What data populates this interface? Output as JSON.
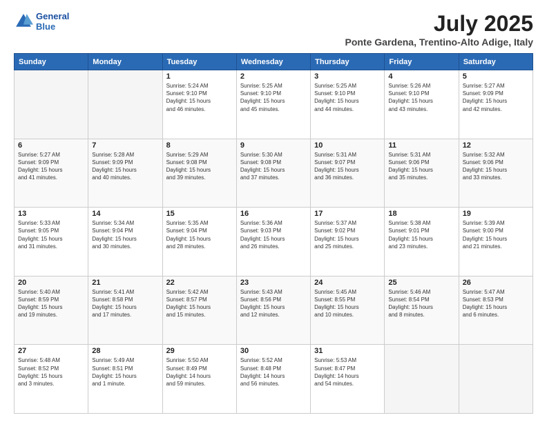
{
  "header": {
    "logo_line1": "General",
    "logo_line2": "Blue",
    "month": "July 2025",
    "location": "Ponte Gardena, Trentino-Alto Adige, Italy"
  },
  "days_of_week": [
    "Sunday",
    "Monday",
    "Tuesday",
    "Wednesday",
    "Thursday",
    "Friday",
    "Saturday"
  ],
  "weeks": [
    [
      {
        "day": "",
        "info": ""
      },
      {
        "day": "",
        "info": ""
      },
      {
        "day": "1",
        "info": "Sunrise: 5:24 AM\nSunset: 9:10 PM\nDaylight: 15 hours\nand 46 minutes."
      },
      {
        "day": "2",
        "info": "Sunrise: 5:25 AM\nSunset: 9:10 PM\nDaylight: 15 hours\nand 45 minutes."
      },
      {
        "day": "3",
        "info": "Sunrise: 5:25 AM\nSunset: 9:10 PM\nDaylight: 15 hours\nand 44 minutes."
      },
      {
        "day": "4",
        "info": "Sunrise: 5:26 AM\nSunset: 9:10 PM\nDaylight: 15 hours\nand 43 minutes."
      },
      {
        "day": "5",
        "info": "Sunrise: 5:27 AM\nSunset: 9:09 PM\nDaylight: 15 hours\nand 42 minutes."
      }
    ],
    [
      {
        "day": "6",
        "info": "Sunrise: 5:27 AM\nSunset: 9:09 PM\nDaylight: 15 hours\nand 41 minutes."
      },
      {
        "day": "7",
        "info": "Sunrise: 5:28 AM\nSunset: 9:09 PM\nDaylight: 15 hours\nand 40 minutes."
      },
      {
        "day": "8",
        "info": "Sunrise: 5:29 AM\nSunset: 9:08 PM\nDaylight: 15 hours\nand 39 minutes."
      },
      {
        "day": "9",
        "info": "Sunrise: 5:30 AM\nSunset: 9:08 PM\nDaylight: 15 hours\nand 37 minutes."
      },
      {
        "day": "10",
        "info": "Sunrise: 5:31 AM\nSunset: 9:07 PM\nDaylight: 15 hours\nand 36 minutes."
      },
      {
        "day": "11",
        "info": "Sunrise: 5:31 AM\nSunset: 9:06 PM\nDaylight: 15 hours\nand 35 minutes."
      },
      {
        "day": "12",
        "info": "Sunrise: 5:32 AM\nSunset: 9:06 PM\nDaylight: 15 hours\nand 33 minutes."
      }
    ],
    [
      {
        "day": "13",
        "info": "Sunrise: 5:33 AM\nSunset: 9:05 PM\nDaylight: 15 hours\nand 31 minutes."
      },
      {
        "day": "14",
        "info": "Sunrise: 5:34 AM\nSunset: 9:04 PM\nDaylight: 15 hours\nand 30 minutes."
      },
      {
        "day": "15",
        "info": "Sunrise: 5:35 AM\nSunset: 9:04 PM\nDaylight: 15 hours\nand 28 minutes."
      },
      {
        "day": "16",
        "info": "Sunrise: 5:36 AM\nSunset: 9:03 PM\nDaylight: 15 hours\nand 26 minutes."
      },
      {
        "day": "17",
        "info": "Sunrise: 5:37 AM\nSunset: 9:02 PM\nDaylight: 15 hours\nand 25 minutes."
      },
      {
        "day": "18",
        "info": "Sunrise: 5:38 AM\nSunset: 9:01 PM\nDaylight: 15 hours\nand 23 minutes."
      },
      {
        "day": "19",
        "info": "Sunrise: 5:39 AM\nSunset: 9:00 PM\nDaylight: 15 hours\nand 21 minutes."
      }
    ],
    [
      {
        "day": "20",
        "info": "Sunrise: 5:40 AM\nSunset: 8:59 PM\nDaylight: 15 hours\nand 19 minutes."
      },
      {
        "day": "21",
        "info": "Sunrise: 5:41 AM\nSunset: 8:58 PM\nDaylight: 15 hours\nand 17 minutes."
      },
      {
        "day": "22",
        "info": "Sunrise: 5:42 AM\nSunset: 8:57 PM\nDaylight: 15 hours\nand 15 minutes."
      },
      {
        "day": "23",
        "info": "Sunrise: 5:43 AM\nSunset: 8:56 PM\nDaylight: 15 hours\nand 12 minutes."
      },
      {
        "day": "24",
        "info": "Sunrise: 5:45 AM\nSunset: 8:55 PM\nDaylight: 15 hours\nand 10 minutes."
      },
      {
        "day": "25",
        "info": "Sunrise: 5:46 AM\nSunset: 8:54 PM\nDaylight: 15 hours\nand 8 minutes."
      },
      {
        "day": "26",
        "info": "Sunrise: 5:47 AM\nSunset: 8:53 PM\nDaylight: 15 hours\nand 6 minutes."
      }
    ],
    [
      {
        "day": "27",
        "info": "Sunrise: 5:48 AM\nSunset: 8:52 PM\nDaylight: 15 hours\nand 3 minutes."
      },
      {
        "day": "28",
        "info": "Sunrise: 5:49 AM\nSunset: 8:51 PM\nDaylight: 15 hours\nand 1 minute."
      },
      {
        "day": "29",
        "info": "Sunrise: 5:50 AM\nSunset: 8:49 PM\nDaylight: 14 hours\nand 59 minutes."
      },
      {
        "day": "30",
        "info": "Sunrise: 5:52 AM\nSunset: 8:48 PM\nDaylight: 14 hours\nand 56 minutes."
      },
      {
        "day": "31",
        "info": "Sunrise: 5:53 AM\nSunset: 8:47 PM\nDaylight: 14 hours\nand 54 minutes."
      },
      {
        "day": "",
        "info": ""
      },
      {
        "day": "",
        "info": ""
      }
    ]
  ]
}
